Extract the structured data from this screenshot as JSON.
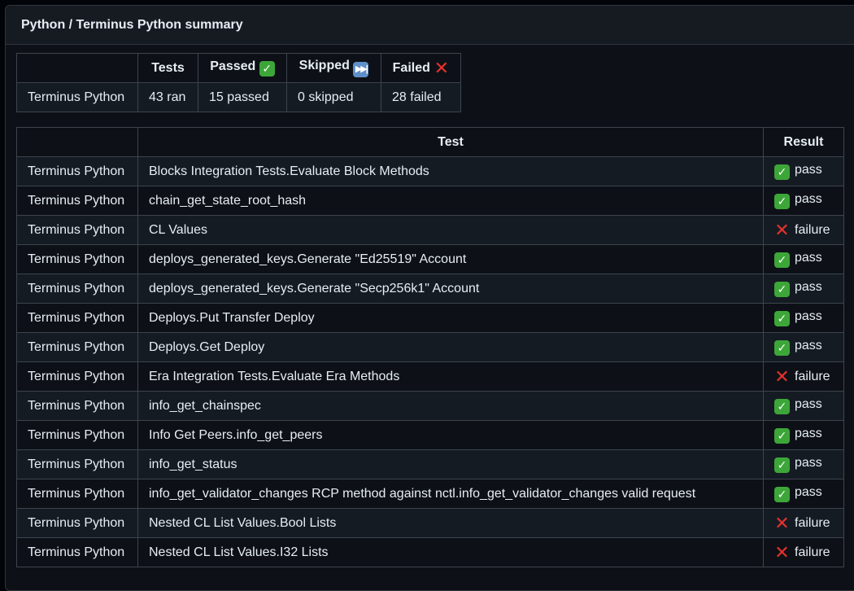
{
  "panel": {
    "title": "Python / Terminus Python summary"
  },
  "summary": {
    "headers": [
      "",
      "Tests",
      "Passed",
      "Skipped",
      "Failed"
    ],
    "header_icons": [
      "",
      "",
      "check-icon",
      "skip-icon",
      "cross-icon"
    ],
    "row": [
      "Terminus Python",
      "43 ran",
      "15 passed",
      "0 skipped",
      "28 failed"
    ]
  },
  "details": {
    "headers": [
      "",
      "Test",
      "Result"
    ],
    "rows": [
      {
        "suite": "Terminus Python",
        "test": "Blocks Integration Tests.Evaluate Block Methods",
        "result": "pass"
      },
      {
        "suite": "Terminus Python",
        "test": "chain_get_state_root_hash",
        "result": "pass"
      },
      {
        "suite": "Terminus Python",
        "test": "CL Values",
        "result": "failure"
      },
      {
        "suite": "Terminus Python",
        "test": "deploys_generated_keys.Generate \"Ed25519\" Account",
        "result": "pass"
      },
      {
        "suite": "Terminus Python",
        "test": "deploys_generated_keys.Generate \"Secp256k1\" Account",
        "result": "pass"
      },
      {
        "suite": "Terminus Python",
        "test": "Deploys.Put Transfer Deploy",
        "result": "pass"
      },
      {
        "suite": "Terminus Python",
        "test": "Deploys.Get Deploy",
        "result": "pass"
      },
      {
        "suite": "Terminus Python",
        "test": "Era Integration Tests.Evaluate Era Methods",
        "result": "failure"
      },
      {
        "suite": "Terminus Python",
        "test": "info_get_chainspec",
        "result": "pass"
      },
      {
        "suite": "Terminus Python",
        "test": "Info Get Peers.info_get_peers",
        "result": "pass"
      },
      {
        "suite": "Terminus Python",
        "test": "info_get_status",
        "result": "pass"
      },
      {
        "suite": "Terminus Python",
        "test": "info_get_validator_changes RCP method against nctl.info_get_validator_changes valid request",
        "result": "pass"
      },
      {
        "suite": "Terminus Python",
        "test": "Nested CL List Values.Bool Lists",
        "result": "failure"
      },
      {
        "suite": "Terminus Python",
        "test": "Nested CL List Values.I32 Lists",
        "result": "failure"
      }
    ]
  },
  "colors": {
    "background": "#0d1117",
    "header_bg": "#161b22",
    "alt_row": "#151b23",
    "border": "#3d444d",
    "pass_green": "#3da639",
    "fail_red": "#e5322d",
    "skip_blue": "#5f8fc9"
  }
}
